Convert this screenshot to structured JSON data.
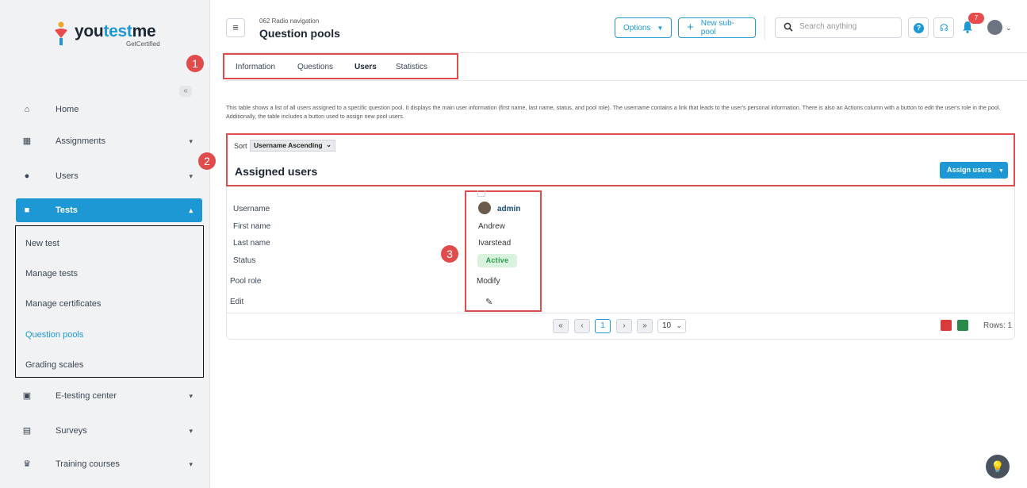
{
  "brand": {
    "name_prefix": "you",
    "name_accent": "test",
    "name_suffix": "me",
    "tagline": "GetCertified"
  },
  "sidebar": {
    "items": [
      {
        "label": "Home",
        "icon": "home-icon"
      },
      {
        "label": "Assignments",
        "icon": "assignments-icon"
      },
      {
        "label": "Users",
        "icon": "users-icon"
      },
      {
        "label": "Tests",
        "icon": "tests-icon"
      },
      {
        "label": "E-testing center",
        "icon": "e-testing-icon"
      },
      {
        "label": "Surveys",
        "icon": "surveys-icon"
      },
      {
        "label": "Training courses",
        "icon": "trophy-icon"
      }
    ],
    "tests_submenu": [
      "New test",
      "Manage tests",
      "Manage certificates",
      "Question pools",
      "Grading scales"
    ]
  },
  "header": {
    "breadcrumb": "062 Radio navigation",
    "title": "Question pools",
    "options_label": "Options",
    "new_subpool_label": "New sub-pool",
    "search_placeholder": "Search anything",
    "notification_count": "7"
  },
  "tabs": [
    "Information",
    "Questions",
    "Users",
    "Statistics"
  ],
  "active_tab": "Users",
  "markers": [
    "1",
    "2",
    "3"
  ],
  "description": "This table shows a list of all users assigned to a specific question pool. It displays the main user information (first name, last name, status, and pool role). The username contains a link that leads to the user's personal information. There is also an Actions column with a button to edit the user's role in the pool. Additionally, the table includes a button used to assign new pool users.",
  "assigned": {
    "sort_label": "Sort",
    "sort_value": "Username Ascending",
    "title": "Assigned users",
    "assign_button": "Assign users",
    "fields": {
      "username": "Username",
      "first_name": "First name",
      "last_name": "Last name",
      "status": "Status",
      "pool_role": "Pool role",
      "edit": "Edit"
    },
    "user": {
      "username": "admin",
      "first_name": "Andrew",
      "last_name": "Ivarstead",
      "status": "Active",
      "pool_role": "Modify"
    }
  },
  "pager": {
    "current_page": "1",
    "page_size": "10",
    "rows_text": "Rows: 1"
  },
  "colors": {
    "accent": "#1e98d4",
    "annotation": "#e04b4b",
    "status_active": "#2b9a4a"
  }
}
